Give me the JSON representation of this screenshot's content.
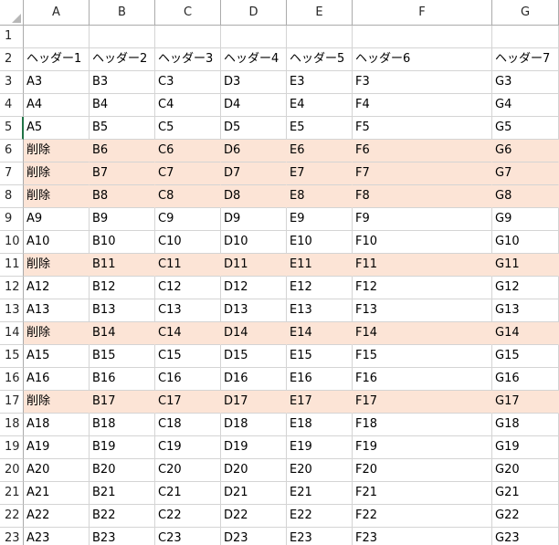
{
  "columns": [
    "A",
    "B",
    "C",
    "D",
    "E",
    "F",
    "G"
  ],
  "rows": [
    {
      "num": "1",
      "cells": [
        "",
        "",
        "",
        "",
        "",
        "",
        ""
      ],
      "highlight": false
    },
    {
      "num": "2",
      "cells": [
        "ヘッダー1",
        "ヘッダー2",
        "ヘッダー3",
        "ヘッダー4",
        "ヘッダー5",
        "ヘッダー6",
        "ヘッダー7"
      ],
      "highlight": false
    },
    {
      "num": "3",
      "cells": [
        "A3",
        "B3",
        "C3",
        "D3",
        "E3",
        "F3",
        "G3"
      ],
      "highlight": false
    },
    {
      "num": "4",
      "cells": [
        "A4",
        "B4",
        "C4",
        "D4",
        "E4",
        "F4",
        "G4"
      ],
      "highlight": false
    },
    {
      "num": "5",
      "cells": [
        "A5",
        "B5",
        "C5",
        "D5",
        "E5",
        "F5",
        "G5"
      ],
      "highlight": false,
      "active": true
    },
    {
      "num": "6",
      "cells": [
        "削除",
        "B6",
        "C6",
        "D6",
        "E6",
        "F6",
        "G6"
      ],
      "highlight": true
    },
    {
      "num": "7",
      "cells": [
        "削除",
        "B7",
        "C7",
        "D7",
        "E7",
        "F7",
        "G7"
      ],
      "highlight": true
    },
    {
      "num": "8",
      "cells": [
        "削除",
        "B8",
        "C8",
        "D8",
        "E8",
        "F8",
        "G8"
      ],
      "highlight": true
    },
    {
      "num": "9",
      "cells": [
        "A9",
        "B9",
        "C9",
        "D9",
        "E9",
        "F9",
        "G9"
      ],
      "highlight": false
    },
    {
      "num": "10",
      "cells": [
        "A10",
        "B10",
        "C10",
        "D10",
        "E10",
        "F10",
        "G10"
      ],
      "highlight": false
    },
    {
      "num": "11",
      "cells": [
        "削除",
        "B11",
        "C11",
        "D11",
        "E11",
        "F11",
        "G11"
      ],
      "highlight": true
    },
    {
      "num": "12",
      "cells": [
        "A12",
        "B12",
        "C12",
        "D12",
        "E12",
        "F12",
        "G12"
      ],
      "highlight": false
    },
    {
      "num": "13",
      "cells": [
        "A13",
        "B13",
        "C13",
        "D13",
        "E13",
        "F13",
        "G13"
      ],
      "highlight": false
    },
    {
      "num": "14",
      "cells": [
        "削除",
        "B14",
        "C14",
        "D14",
        "E14",
        "F14",
        "G14"
      ],
      "highlight": true
    },
    {
      "num": "15",
      "cells": [
        "A15",
        "B15",
        "C15",
        "D15",
        "E15",
        "F15",
        "G15"
      ],
      "highlight": false
    },
    {
      "num": "16",
      "cells": [
        "A16",
        "B16",
        "C16",
        "D16",
        "E16",
        "F16",
        "G16"
      ],
      "highlight": false
    },
    {
      "num": "17",
      "cells": [
        "削除",
        "B17",
        "C17",
        "D17",
        "E17",
        "F17",
        "G17"
      ],
      "highlight": true
    },
    {
      "num": "18",
      "cells": [
        "A18",
        "B18",
        "C18",
        "D18",
        "E18",
        "F18",
        "G18"
      ],
      "highlight": false
    },
    {
      "num": "19",
      "cells": [
        "A19",
        "B19",
        "C19",
        "D19",
        "E19",
        "F19",
        "G19"
      ],
      "highlight": false
    },
    {
      "num": "20",
      "cells": [
        "A20",
        "B20",
        "C20",
        "D20",
        "E20",
        "F20",
        "G20"
      ],
      "highlight": false
    },
    {
      "num": "21",
      "cells": [
        "A21",
        "B21",
        "C21",
        "D21",
        "E21",
        "F21",
        "G21"
      ],
      "highlight": false
    },
    {
      "num": "22",
      "cells": [
        "A22",
        "B22",
        "C22",
        "D22",
        "E22",
        "F22",
        "G22"
      ],
      "highlight": false
    },
    {
      "num": "23",
      "cells": [
        "A23",
        "B23",
        "C23",
        "D23",
        "E23",
        "F23",
        "G23"
      ],
      "highlight": false
    }
  ],
  "colors": {
    "highlight": "#fce4d6",
    "gridline": "#d4d4d4",
    "active_indicator": "#217346"
  }
}
